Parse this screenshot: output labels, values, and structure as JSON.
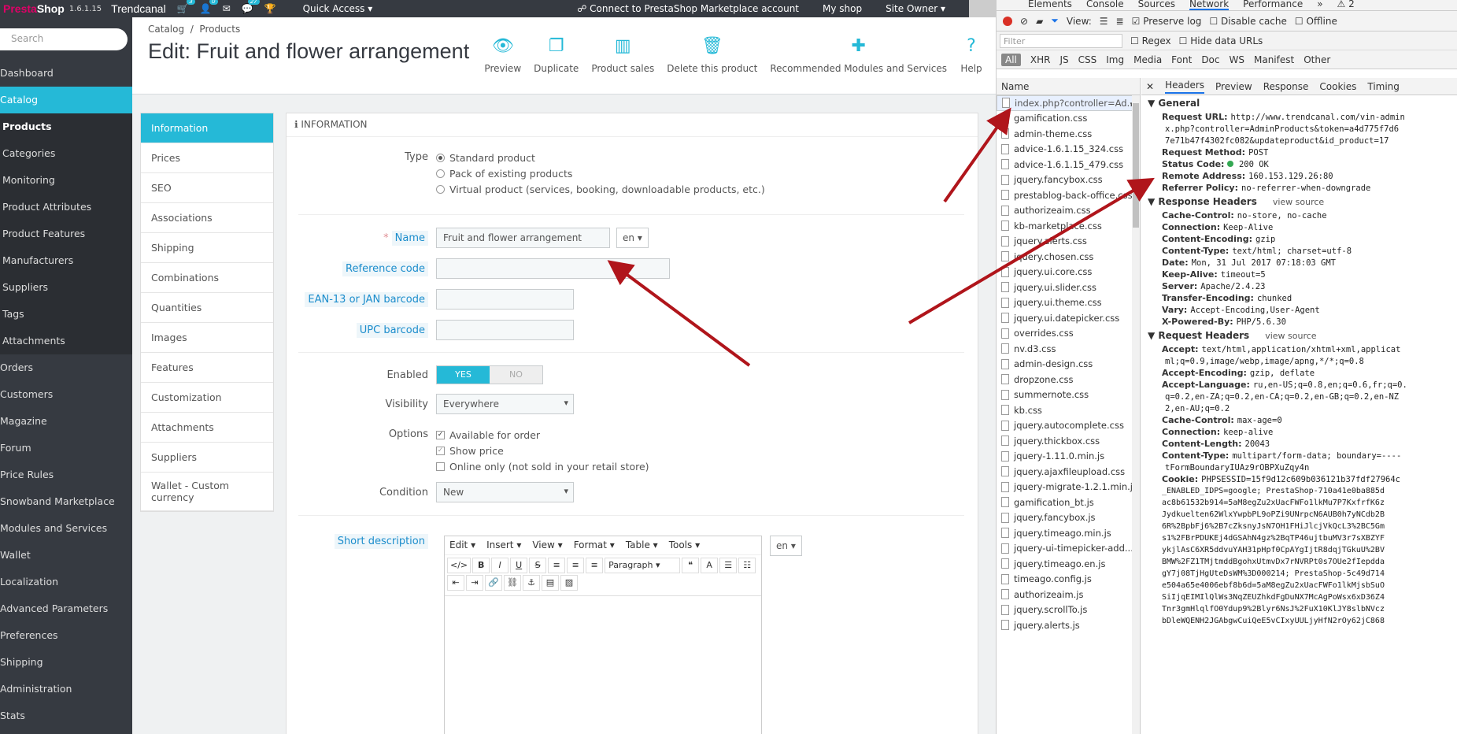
{
  "topbar": {
    "logo_a": "Presta",
    "logo_b": "Shop",
    "version": "1.6.1.15",
    "store_name": "Trendcanal",
    "badges": [
      "3",
      "0",
      "",
      "27"
    ],
    "quick_access": "Quick Access",
    "marketplace": "Connect to PrestaShop Marketplace account",
    "my_shop": "My shop",
    "site_owner": "Site Owner"
  },
  "sidebar": {
    "search_placeholder": "Search",
    "items": [
      "Dashboard",
      "Catalog",
      "Products",
      "Categories",
      "Monitoring",
      "Product Attributes",
      "Product Features",
      "Manufacturers",
      "Suppliers",
      "Tags",
      "Attachments",
      "Orders",
      "Customers",
      "Magazine",
      "Forum",
      "Price Rules",
      "Snowband Marketplace",
      "Modules and Services",
      "Wallet",
      "Localization",
      "Advanced Parameters",
      "Preferences",
      "Shipping",
      "Administration",
      "Stats"
    ]
  },
  "header": {
    "breadcrumb_1": "Catalog",
    "breadcrumb_sep": "/",
    "breadcrumb_2": "Products",
    "title": "Edit: Fruit and flower arrangement",
    "toolbar": [
      "Preview",
      "Duplicate",
      "Product sales",
      "Delete this product",
      "Recommended Modules and Services",
      "Help"
    ]
  },
  "tabs": [
    "Information",
    "Prices",
    "SEO",
    "Associations",
    "Shipping",
    "Combinations",
    "Quantities",
    "Images",
    "Features",
    "Customization",
    "Attachments",
    "Suppliers",
    "Wallet - Custom currency"
  ],
  "panel": {
    "heading": "INFORMATION",
    "type_label": "Type",
    "type_options": [
      "Standard product",
      "Pack of existing products",
      "Virtual product (services, booking, downloadable products, etc.)"
    ],
    "name_label": "Name",
    "name_value": "Fruit and flower arrangement",
    "lang": "en",
    "reference_label": "Reference code",
    "ean_label": "EAN-13 or JAN barcode",
    "upc_label": "UPC barcode",
    "enabled_label": "Enabled",
    "yes": "YES",
    "no": "NO",
    "visibility_label": "Visibility",
    "visibility_value": "Everywhere",
    "options_label": "Options",
    "options": [
      "Available for order",
      "Show price",
      "Online only (not sold in your retail store)"
    ],
    "condition_label": "Condition",
    "condition_value": "New",
    "short_desc_label": "Short description",
    "editor_menu": [
      "Edit",
      "Insert",
      "View",
      "Format",
      "Table",
      "Tools"
    ],
    "editor_paragraph": "Paragraph"
  },
  "devtools": {
    "top_tabs": [
      "Elements",
      "Console",
      "Sources",
      "Network",
      "Performance"
    ],
    "warnings": "2",
    "view_label": "View:",
    "preserve_log": "Preserve log",
    "disable_cache": "Disable cache",
    "offline": "Offline",
    "filter_placeholder": "Filter",
    "regex": "Regex",
    "hide_data_urls": "Hide data URLs",
    "types": [
      "All",
      "XHR",
      "JS",
      "CSS",
      "Img",
      "Media",
      "Font",
      "Doc",
      "WS",
      "Manifest",
      "Other"
    ],
    "name_header": "Name",
    "files": [
      "index.php?controller=Ad...",
      "gamification.css",
      "admin-theme.css",
      "advice-1.6.1.15_324.css",
      "advice-1.6.1.15_479.css",
      "jquery.fancybox.css",
      "prestablog-back-office.css",
      "authorizeaim.css",
      "kb-marketplace.css",
      "jquery.alerts.css",
      "jquery.chosen.css",
      "jquery.ui.core.css",
      "jquery.ui.slider.css",
      "jquery.ui.theme.css",
      "jquery.ui.datepicker.css",
      "overrides.css",
      "nv.d3.css",
      "admin-design.css",
      "dropzone.css",
      "summernote.css",
      "kb.css",
      "jquery.autocomplete.css",
      "jquery.thickbox.css",
      "jquery-1.11.0.min.js",
      "jquery.ajaxfileupload.css",
      "jquery-migrate-1.2.1.min.js",
      "gamification_bt.js",
      "jquery.fancybox.js",
      "jquery.timeago.min.js",
      "jquery-ui-timepicker-add...",
      "jquery.timeago.en.js",
      "timeago.config.js",
      "authorizeaim.js",
      "jquery.scrollTo.js",
      "jquery.alerts.js"
    ],
    "detail_tabs": [
      "Headers",
      "Preview",
      "Response",
      "Cookies",
      "Timing"
    ],
    "general_title": "General",
    "general": [
      {
        "k": "Request URL:",
        "v": "http://www.trendcanal.com/vin-admin"
      },
      {
        "k": "",
        "v": "x.php?controller=AdminProducts&token=a4d775f7d6"
      },
      {
        "k": "",
        "v": "7e71b47f4302fc082&updateproduct&id_product=17"
      },
      {
        "k": "Request Method:",
        "v": "POST"
      },
      {
        "k": "Status Code:",
        "v": "200 OK"
      },
      {
        "k": "Remote Address:",
        "v": "160.153.129.26:80"
      },
      {
        "k": "Referrer Policy:",
        "v": "no-referrer-when-downgrade"
      }
    ],
    "response_title": "Response Headers",
    "view_source": "view source",
    "response": [
      {
        "k": "Cache-Control:",
        "v": "no-store, no-cache"
      },
      {
        "k": "Connection:",
        "v": "Keep-Alive"
      },
      {
        "k": "Content-Encoding:",
        "v": "gzip"
      },
      {
        "k": "Content-Type:",
        "v": "text/html; charset=utf-8"
      },
      {
        "k": "Date:",
        "v": "Mon, 31 Jul 2017 07:18:03 GMT"
      },
      {
        "k": "Keep-Alive:",
        "v": "timeout=5"
      },
      {
        "k": "Server:",
        "v": "Apache/2.4.23"
      },
      {
        "k": "Transfer-Encoding:",
        "v": "chunked"
      },
      {
        "k": "Vary:",
        "v": "Accept-Encoding,User-Agent"
      },
      {
        "k": "X-Powered-By:",
        "v": "PHP/5.6.30"
      }
    ],
    "request_title": "Request Headers",
    "request": [
      {
        "k": "Accept:",
        "v": "text/html,application/xhtml+xml,applicat"
      },
      {
        "k": "",
        "v": "ml;q=0.9,image/webp,image/apng,*/*;q=0.8"
      },
      {
        "k": "Accept-Encoding:",
        "v": "gzip, deflate"
      },
      {
        "k": "Accept-Language:",
        "v": "ru,en-US;q=0.8,en;q=0.6,fr;q=0."
      },
      {
        "k": "",
        "v": "q=0.2,en-ZA;q=0.2,en-CA;q=0.2,en-GB;q=0.2,en-NZ"
      },
      {
        "k": "",
        "v": "2,en-AU;q=0.2"
      },
      {
        "k": "Cache-Control:",
        "v": "max-age=0"
      },
      {
        "k": "Connection:",
        "v": "keep-alive"
      },
      {
        "k": "Content-Length:",
        "v": "20043"
      },
      {
        "k": "Content-Type:",
        "v": "multipart/form-data; boundary=----"
      },
      {
        "k": "",
        "v": "tFormBoundaryIUAz9rOBPXuZqy4n"
      },
      {
        "k": "Cookie:",
        "v": "PHPSESSID=15f9d12c609b036121b37fdf27964c"
      }
    ],
    "cookie_lines": [
      "_ENABLED_IDPS=google; PrestaShop-710a41e0ba885d",
      "ac8b61532b914=5aM8egZu2xUacFWFo1lkMu7P7KxfrfK6z",
      "Jydkuelten62WlxYwpbPL9oPZi9UNrpcN6AUB0h7yNCdb2B",
      "6R%2BpbFj6%2B7cZksnyJsN7OH1FHiJlcjVkQcL3%2BC5Gm",
      "s1%2FBrPDUKEj4dGSAhN4gz%2BqTP46ujtbuMV3r7sXBZYF",
      "ykjlAsC6XR5ddvuYAH31pHpf0CpAYgIjtR8dqjTGkuU%2BV",
      "BMW%2FZ1TMjtmddBgohxUtmvDx7rNVRPt0s7OUe2fIepdda",
      "gY7j08TjHgUteDsWM%3D000214; PrestaShop-5c49d714",
      "e504a65e4006ebf8b6d=5aM8egZu2xUacFWFo1lkMjsbSuO",
      "SiIjqEIMIlQlWs3NqZEUZhkdFgDuNX7McAgPoWsx6xD36Z4",
      "Tnr3gmHlqlfO0Ydup9%2Blyr6NsJ%2FuX10KlJY8slbNVcz",
      "bDleWQENH2JGAbgwCuiQeE5vCIxyUULjyHfN2rOy62jC868"
    ]
  }
}
